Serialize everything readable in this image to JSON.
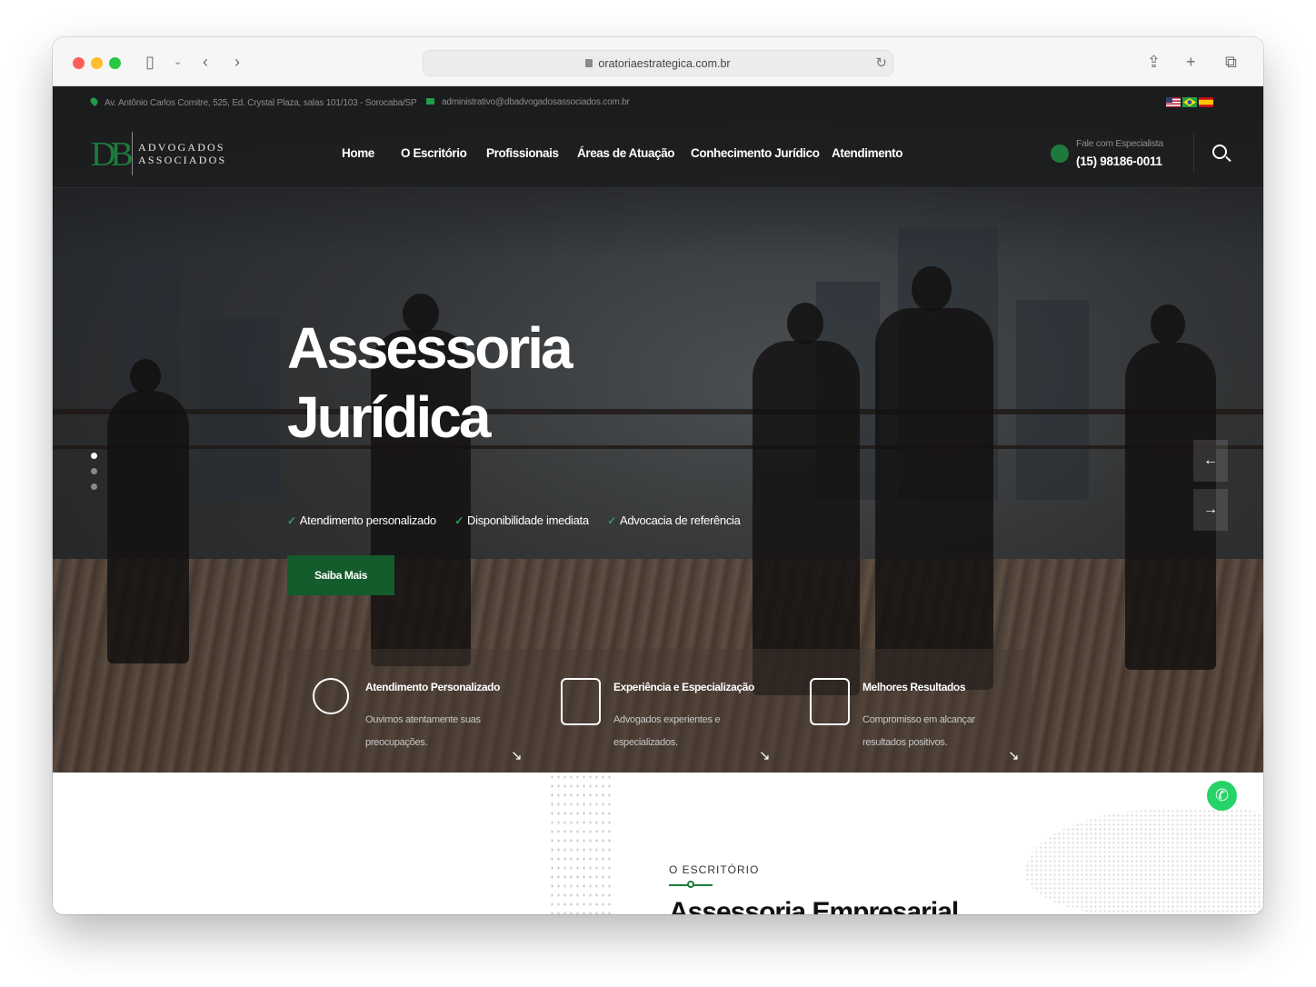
{
  "browser": {
    "url": "oratoriaestrategica.com.br"
  },
  "topbar": {
    "address": "Av. Antônio Carlos Comitre, 525, Ed. Crystal Plaza, salas 101/103 - Sorocaba/SP",
    "email": "administrativo@dbadvogadosassociados.com.br",
    "flags": [
      "us-flag",
      "br-flag",
      "es-flag"
    ]
  },
  "logo": {
    "mark": "DB",
    "line1": "ADVOGADOS",
    "line2": "ASSOCIADOS"
  },
  "nav": {
    "items": [
      {
        "label": "Home"
      },
      {
        "label": "O Escritório"
      },
      {
        "label": "Profissionais"
      },
      {
        "label": "Áreas de Atuação"
      },
      {
        "label": "Conhecimento Jurídico"
      },
      {
        "label": "Atendimento"
      }
    ],
    "contact_label": "Fale com Especialista",
    "contact_phone": "(15) 98186-0011"
  },
  "hero": {
    "title_line1": "Assessoria",
    "title_line2": "Jurídica",
    "features": [
      "Atendimento personalizado",
      "Disponibilidade imediata",
      "Advocacia de referência"
    ],
    "cta": "Saiba Mais",
    "prev_arrow": "←",
    "next_arrow": "→"
  },
  "cards": [
    {
      "title": "Atendimento Personalizado",
      "desc": "Ouvimos atentamente suas preocupações.",
      "icon": "globe-people-icon"
    },
    {
      "title": "Experiência e Especialização",
      "desc": "Advogados experientes e especializados.",
      "icon": "certificate-icon"
    },
    {
      "title": "Melhores Resultados",
      "desc": "Compromisso em alcançar resultados positivos.",
      "icon": "document-checklist-icon"
    }
  ],
  "section": {
    "kicker": "O ESCRITÓRIO",
    "title": "Assessoria Empresarial"
  },
  "colors": {
    "accent": "#1d7a3c",
    "cta": "#145c2b",
    "topbar": "#1b1c1e"
  }
}
